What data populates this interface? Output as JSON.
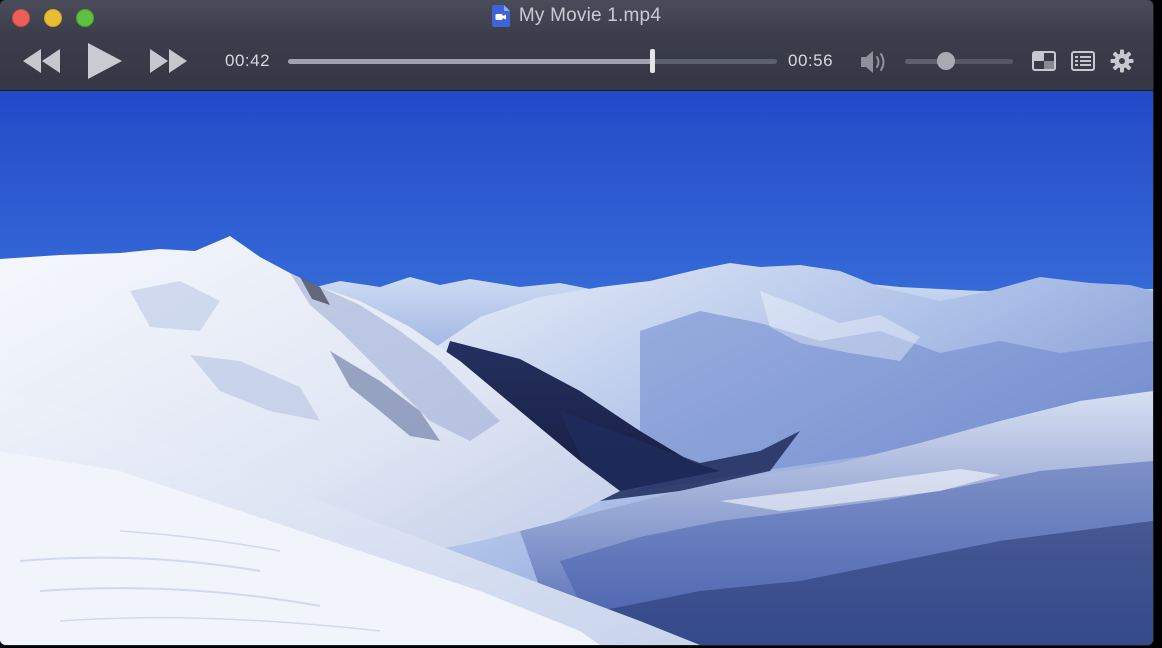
{
  "window": {
    "title": "My Movie 1.mp4",
    "traffic_lights": [
      {
        "name": "close",
        "color": "#ec5f58"
      },
      {
        "name": "minimize",
        "color": "#e9bd31"
      },
      {
        "name": "zoom",
        "color": "#5fbf3e"
      }
    ]
  },
  "player": {
    "elapsed": "00:42",
    "total": "00:56",
    "progress_fraction": 0.744,
    "volume_fraction": 0.38,
    "icons": {
      "rewind": "rewind-icon",
      "play": "play-icon",
      "fast_forward": "fast-forward-icon",
      "volume": "speaker-icon",
      "pip": "picture-in-picture-icon",
      "playlist": "playlist-icon",
      "settings": "gear-icon"
    }
  },
  "video": {
    "content": "snow-covered-mountains-scene"
  },
  "colors": {
    "titlebar": "#3b3d4b",
    "control_icon": "#c6c8d0",
    "accent_file_icon": "#3f63d8"
  }
}
